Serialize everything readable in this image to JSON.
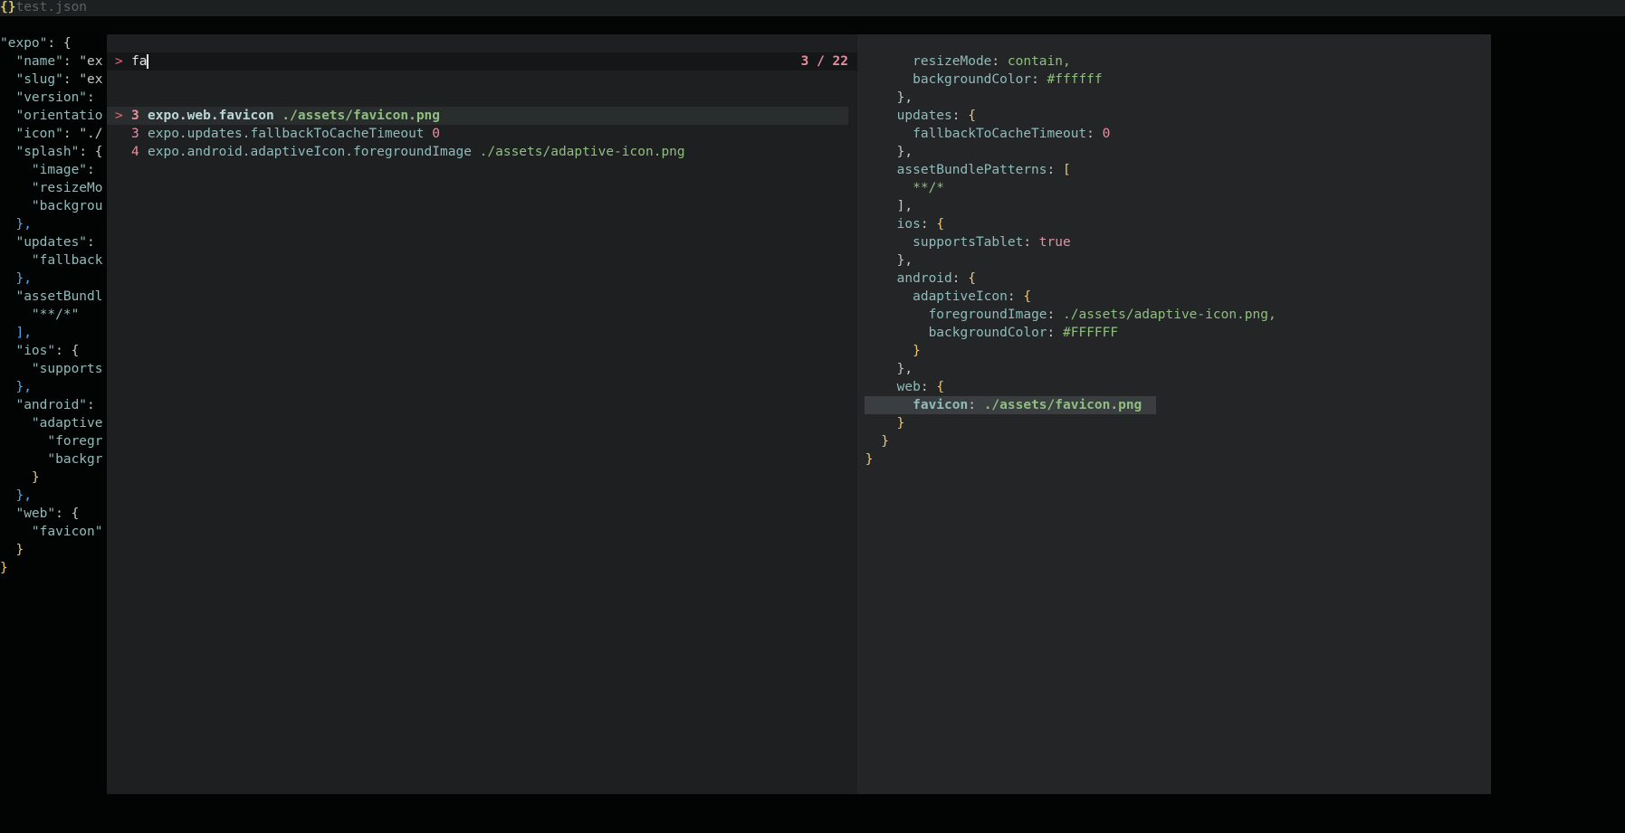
{
  "tab": {
    "icon": "{}",
    "name": "test.json"
  },
  "editor": {
    "lines": [
      [
        "",
        "\"expo\"",
        ": {"
      ],
      [
        "  ",
        "\"name\"",
        ": \"ex"
      ],
      [
        "  ",
        "\"slug\"",
        ": \"ex"
      ],
      [
        "  ",
        "\"version\"",
        ":"
      ],
      [
        "  ",
        "\"orientatio",
        ""
      ],
      [
        "  ",
        "\"icon\"",
        ": \"./"
      ],
      [
        "  ",
        "\"splash\"",
        ": {"
      ],
      [
        "    ",
        "\"image\"",
        ":"
      ],
      [
        "    ",
        "\"resizeMo",
        ""
      ],
      [
        "    ",
        "\"backgrou",
        ""
      ],
      [
        "  ",
        "",
        "},"
      ],
      [
        "  ",
        "\"updates\"",
        ":"
      ],
      [
        "    ",
        "\"fallback",
        ""
      ],
      [
        "  ",
        "",
        "},"
      ],
      [
        "  ",
        "\"assetBundl",
        ""
      ],
      [
        "    ",
        "\"**/*\"",
        ""
      ],
      [
        "  ",
        "",
        "],"
      ],
      [
        "  ",
        "\"ios\"",
        ": {"
      ],
      [
        "    ",
        "\"supports",
        ""
      ],
      [
        "  ",
        "",
        "},"
      ],
      [
        "  ",
        "\"android\"",
        ":"
      ],
      [
        "    ",
        "\"adaptive",
        ""
      ],
      [
        "      ",
        "\"foregr",
        ""
      ],
      [
        "      ",
        "\"backgr",
        ""
      ],
      [
        "    ",
        "",
        "}"
      ],
      [
        "  ",
        "",
        "},"
      ],
      [
        "  ",
        "\"web\"",
        ": {"
      ],
      [
        "    ",
        "\"favicon\"",
        ""
      ],
      [
        "  ",
        "",
        "}"
      ],
      [
        "",
        "",
        "}"
      ]
    ]
  },
  "palette": {
    "prompt": ">",
    "query": "fa",
    "counter": "3 / 22",
    "results": [
      {
        "marker": ">",
        "line": "3",
        "path": "expo.web.favicon",
        "value": "./assets/favicon.png",
        "value_type": "string",
        "selected": true
      },
      {
        "marker": "",
        "line": "3",
        "path": "expo.updates.fallbackToCacheTimeout",
        "value": "0",
        "value_type": "number",
        "selected": false
      },
      {
        "marker": "",
        "line": "4",
        "path": "expo.android.adaptiveIcon.foregroundImage",
        "value": "./assets/adaptive-icon.png",
        "value_type": "string",
        "selected": false
      }
    ]
  },
  "preview": {
    "lines": [
      {
        "indent": 6,
        "key": "resizeMode",
        "value": "contain,",
        "vtype": "s"
      },
      {
        "indent": 6,
        "key": "backgroundColor",
        "value": "#ffffff",
        "vtype": "s"
      },
      {
        "indent": 4,
        "punct": "},",
        "vtype": "b"
      },
      {
        "indent": 4,
        "key": "updates",
        "value": "{",
        "vtype": "b"
      },
      {
        "indent": 6,
        "key": "fallbackToCacheTimeout",
        "value": "0",
        "vtype": "n"
      },
      {
        "indent": 4,
        "punct": "},",
        "vtype": "b"
      },
      {
        "indent": 4,
        "key": "assetBundlePatterns",
        "value": "[",
        "vtype": "b"
      },
      {
        "indent": 6,
        "punct": "**/*",
        "vtype": "s"
      },
      {
        "indent": 4,
        "punct": "],",
        "vtype": "b"
      },
      {
        "indent": 4,
        "key": "ios",
        "value": "{",
        "vtype": "b"
      },
      {
        "indent": 6,
        "key": "supportsTablet",
        "value": "true",
        "vtype": "n"
      },
      {
        "indent": 4,
        "punct": "},",
        "vtype": "b"
      },
      {
        "indent": 4,
        "key": "android",
        "value": "{",
        "vtype": "b"
      },
      {
        "indent": 6,
        "key": "adaptiveIcon",
        "value": "{",
        "vtype": "b"
      },
      {
        "indent": 8,
        "key": "foregroundImage",
        "value": "./assets/adaptive-icon.png,",
        "vtype": "s"
      },
      {
        "indent": 8,
        "key": "backgroundColor",
        "value": "#FFFFFF",
        "vtype": "s"
      },
      {
        "indent": 6,
        "punct": "}",
        "vtype": "b"
      },
      {
        "indent": 4,
        "punct": "},",
        "vtype": "b"
      },
      {
        "indent": 4,
        "key": "web",
        "value": "{",
        "vtype": "b"
      },
      {
        "indent": 6,
        "key": "favicon",
        "value": "./assets/favicon.png",
        "vtype": "s",
        "highlight": true
      },
      {
        "indent": 4,
        "punct": "}",
        "vtype": "b"
      },
      {
        "indent": 2,
        "punct": "}",
        "vtype": "b"
      },
      {
        "indent": 0,
        "punct": "}",
        "vtype": "b"
      }
    ]
  }
}
